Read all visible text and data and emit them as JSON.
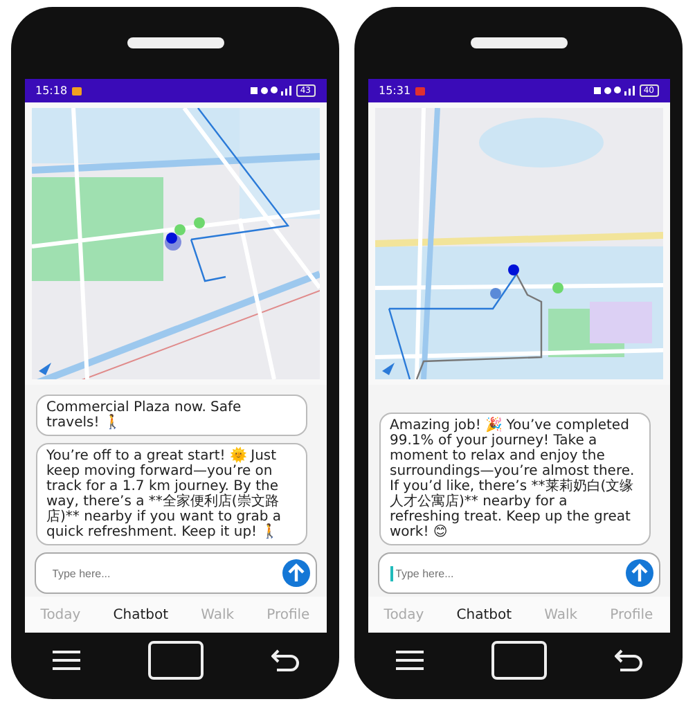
{
  "phones": [
    {
      "status_bar": {
        "time": "15:18",
        "battery": "43"
      },
      "messages": [
        "Commercial Plaza now. Safe travels! 🚶",
        "You’re off to a great start! 🌞 Just keep moving forward—you’re on track for a 1.7 km journey. By the way, there’s a **全家便利店(崇文路店)** nearby if you want to grab a quick refreshment. Keep it up! 🚶"
      ],
      "input": {
        "placeholder": "Type here...",
        "focused": false
      },
      "tabs": [
        {
          "label": "Today",
          "selected": false
        },
        {
          "label": "Chatbot",
          "selected": true
        },
        {
          "label": "Walk",
          "selected": false
        },
        {
          "label": "Profile",
          "selected": false
        }
      ]
    },
    {
      "status_bar": {
        "time": "15:31",
        "battery": "40"
      },
      "messages": [
        "Amazing job! 🎉 You’ve completed 99.1% of your journey! Take a moment to relax and enjoy the surroundings—you’re almost there. If you’d like, there’s **莱莉奶白(文缘人才公寓店)** nearby for a refreshing treat. Keep up the great work! 😊"
      ],
      "input": {
        "placeholder": "Type here...",
        "focused": true
      },
      "tabs": [
        {
          "label": "Today",
          "selected": false
        },
        {
          "label": "Chatbot",
          "selected": true
        },
        {
          "label": "Walk",
          "selected": false
        },
        {
          "label": "Profile",
          "selected": false
        }
      ]
    }
  ]
}
